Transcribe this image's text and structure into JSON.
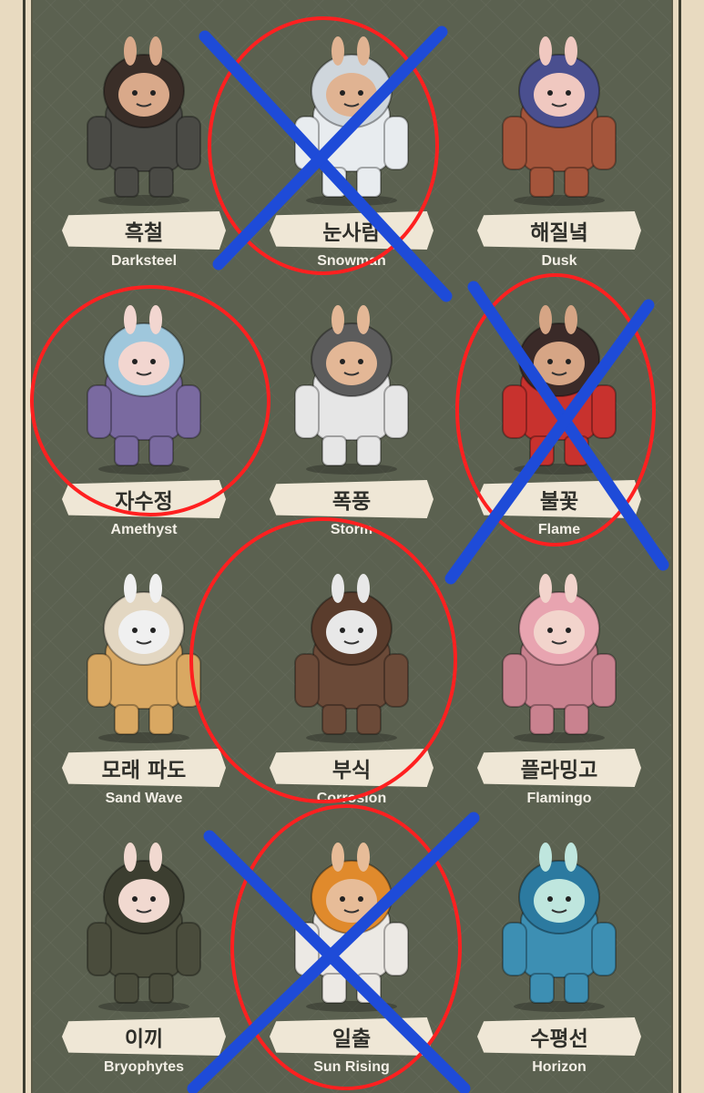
{
  "items": [
    {
      "kor": "흑철",
      "eng": "Darksteel",
      "body": "#4a4a45",
      "head": "#3a2e28",
      "face": "#d9a98a"
    },
    {
      "kor": "눈사람",
      "eng": "Snowman",
      "body": "#e8ecef",
      "head": "#cfd6dc",
      "face": "#e0b392"
    },
    {
      "kor": "해질녘",
      "eng": "Dusk",
      "body": "#a4553b",
      "head": "#4a4f8f",
      "face": "#f0c8c0"
    },
    {
      "kor": "자수정",
      "eng": "Amethyst",
      "body": "#7a6aa0",
      "head": "#9fc7dc",
      "face": "#f2d6d0"
    },
    {
      "kor": "폭풍",
      "eng": "Storm",
      "body": "#e6e6e6",
      "head": "#5c5c5c",
      "face": "#e3b796"
    },
    {
      "kor": "불꽃",
      "eng": "Flame",
      "body": "#c8322e",
      "head": "#3a2a28",
      "face": "#d6a585"
    },
    {
      "kor": "모래 파도",
      "eng": "Sand Wave",
      "body": "#d9a862",
      "head": "#e3d7c2",
      "face": "#f0f0f0"
    },
    {
      "kor": "부식",
      "eng": "Corrosion",
      "body": "#6b4a38",
      "head": "#5a3c2c",
      "face": "#e8e8e8"
    },
    {
      "kor": "플라밍고",
      "eng": "Flamingo",
      "body": "#c9828f",
      "head": "#e8a4b0",
      "face": "#f2d4cc"
    },
    {
      "kor": "이끼",
      "eng": "Bryophytes",
      "body": "#4a4c3c",
      "head": "#3c3e30",
      "face": "#f1d9d0"
    },
    {
      "kor": "일출",
      "eng": "Sun Rising",
      "body": "#ece9e4",
      "head": "#e08a2c",
      "face": "#e7bc98"
    },
    {
      "kor": "수평선",
      "eng": "Horizon",
      "body": "#3d8fb3",
      "head": "#2c7aa0",
      "face": "#bfe6de"
    }
  ],
  "marks": {
    "circle_color": "#ff2020",
    "cross_color": "#1e4bd8"
  }
}
